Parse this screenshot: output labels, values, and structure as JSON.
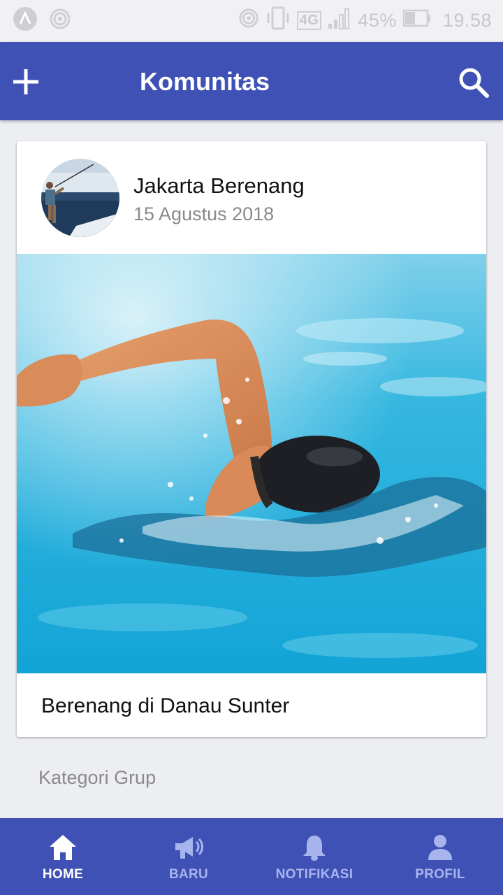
{
  "status_bar": {
    "battery_percent": "45%",
    "network": "4G",
    "time": "19.58"
  },
  "app_bar": {
    "title": "Komunitas",
    "add_icon": "plus-icon",
    "search_icon": "search-icon"
  },
  "post": {
    "group_name": "Jakarta Berenang",
    "date": "15 Agustus 2018",
    "caption": "Berenang di Danau Sunter"
  },
  "section": {
    "label": "Kategori Grup"
  },
  "bottom_nav": {
    "items": [
      {
        "label": "HOME",
        "icon": "home-icon",
        "active": true
      },
      {
        "label": "BARU",
        "icon": "megaphone-icon",
        "active": false
      },
      {
        "label": "NOTIFIKASI",
        "icon": "bell-icon",
        "active": false
      },
      {
        "label": "PROFIL",
        "icon": "person-icon",
        "active": false
      }
    ]
  },
  "colors": {
    "primary": "#3f51b5",
    "nav_inactive": "#a8b4ee",
    "background": "#eceef1"
  }
}
